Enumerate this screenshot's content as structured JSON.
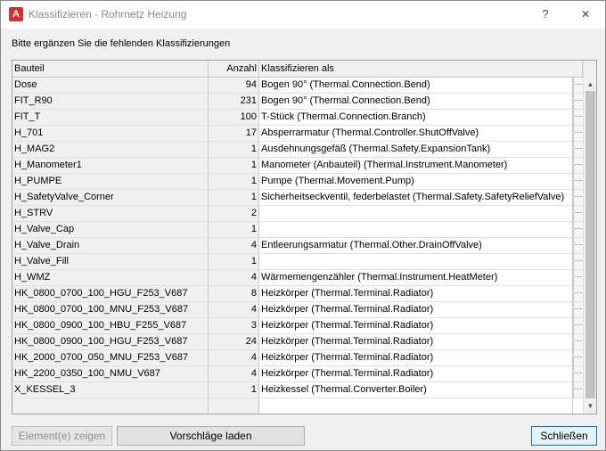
{
  "window": {
    "title": "Klassifizieren - Rohrnetz Heizung",
    "help": "?",
    "close_glyph": "✕"
  },
  "instruction": "Bitte ergänzen Sie die fehlenden Klassifizierungen",
  "table": {
    "columns": [
      "Bauteil",
      "Anzahl",
      "Klassifizieren als"
    ],
    "rows": [
      {
        "bauteil": "Dose",
        "anzahl": "94",
        "klass": "Bogen 90° (Thermal.Connection.Bend)"
      },
      {
        "bauteil": "FIT_R90",
        "anzahl": "231",
        "klass": "Bogen 90° (Thermal.Connection.Bend)"
      },
      {
        "bauteil": "FIT_T",
        "anzahl": "100",
        "klass": "T-Stück (Thermal.Connection.Branch)"
      },
      {
        "bauteil": "H_701",
        "anzahl": "17",
        "klass": "Absperrarmatur (Thermal.Controller.ShutOffValve)"
      },
      {
        "bauteil": "H_MAG2",
        "anzahl": "1",
        "klass": "Ausdehnungsgefäß (Thermal.Safety.ExpansionTank)"
      },
      {
        "bauteil": "H_Manometer1",
        "anzahl": "1",
        "klass": "Manometer (Anbauteil) (Thermal.Instrument.Manometer)"
      },
      {
        "bauteil": "H_PUMPE",
        "anzahl": "1",
        "klass": "Pumpe (Thermal.Movement.Pump)"
      },
      {
        "bauteil": "H_SafetyValve_Corner",
        "anzahl": "1",
        "klass": "Sicherheitseckventil, federbelastet (Thermal.Safety.SafetyReliefValve)"
      },
      {
        "bauteil": "H_STRV",
        "anzahl": "2",
        "klass": ""
      },
      {
        "bauteil": "H_Valve_Cap",
        "anzahl": "1",
        "klass": ""
      },
      {
        "bauteil": "H_Valve_Drain",
        "anzahl": "4",
        "klass": "Entleerungsarmatur (Thermal.Other.DrainOffValve)"
      },
      {
        "bauteil": "H_Valve_Fill",
        "anzahl": "1",
        "klass": ""
      },
      {
        "bauteil": "H_WMZ",
        "anzahl": "4",
        "klass": "Wärmemengenzähler (Thermal.Instrument.HeatMeter)"
      },
      {
        "bauteil": "HK_0800_0700_100_HGU_F253_V687",
        "anzahl": "8",
        "klass": "Heizkörper (Thermal.Terminal.Radiator)"
      },
      {
        "bauteil": "HK_0800_0700_100_MNU_F253_V687",
        "anzahl": "4",
        "klass": "Heizkörper (Thermal.Terminal.Radiator)"
      },
      {
        "bauteil": "HK_0800_0900_100_HBU_F255_V687",
        "anzahl": "3",
        "klass": "Heizkörper (Thermal.Terminal.Radiator)"
      },
      {
        "bauteil": "HK_0800_0900_100_HGU_F253_V687",
        "anzahl": "24",
        "klass": "Heizkörper (Thermal.Terminal.Radiator)"
      },
      {
        "bauteil": "HK_2000_0700_050_MNU_F253_V687",
        "anzahl": "4",
        "klass": "Heizkörper (Thermal.Terminal.Radiator)"
      },
      {
        "bauteil": "HK_2200_0350_100_NMU_V687",
        "anzahl": "4",
        "klass": "Heizkörper (Thermal.Terminal.Radiator)"
      },
      {
        "bauteil": "X_KESSEL_3",
        "anzahl": "1",
        "klass": "Heizkessel (Thermal.Converter.Boiler)"
      }
    ],
    "browse_glyph": "···"
  },
  "buttons": {
    "show": "Element(e) zeigen",
    "load": "Vorschläge laden",
    "close": "Schließen"
  },
  "colors": {
    "app_icon": "#d4302f",
    "close_button_border": "#0078d7"
  }
}
